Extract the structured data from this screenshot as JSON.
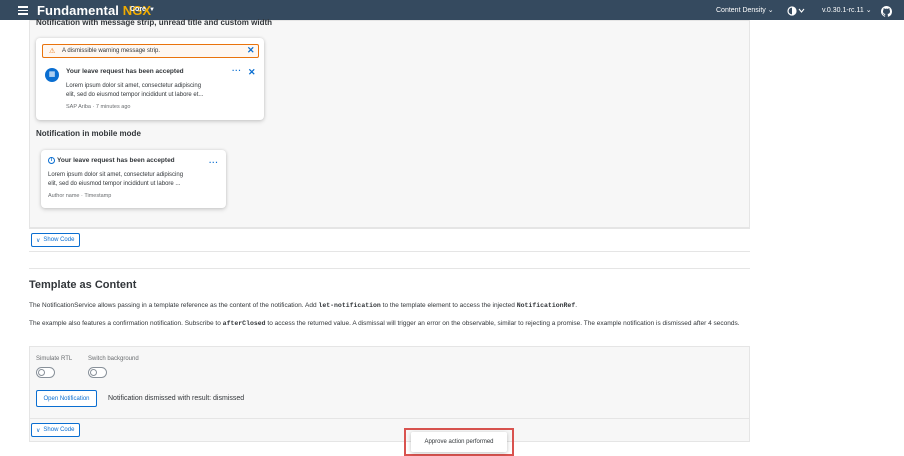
{
  "shell": {
    "brand_main": "Fundamental",
    "brand_accent": "NGX",
    "product": "Core",
    "content_density": "Content Density",
    "theme_icon": "theme-icon",
    "version": "v.0.30.1-rc.11",
    "github_icon": "github-icon"
  },
  "section1": {
    "title": "Notification with message strip, unread title and custom width",
    "strip_text": "A dismissible warning message strip.",
    "card_title": "Your leave request has been accepted",
    "card_body_1": "Lorem ipsum dolor sit amet, consectetur adipiscing",
    "card_body_2": "elit, sed do eiusmod tempor incididunt ut labore et...",
    "card_footer_source": "SAP Ariba",
    "card_footer_sep": "·",
    "card_footer_time": "7 minutes ago",
    "mobile_title": "Notification in mobile mode",
    "mobile_card_title": "Your leave request has been accepted",
    "mobile_body_1": "Lorem ipsum dolor sit amet, consectetur adipiscing",
    "mobile_body_2": "elit, sed do eiusmod tempor incididunt ut labore ...",
    "mobile_footer_author": "Author name",
    "mobile_footer_sep": "·",
    "mobile_footer_time": "Timestamp",
    "show_code": "Show Code"
  },
  "section2": {
    "title": "Template as Content",
    "para1_a": "The NotificationService allows passing in a template reference as the content of the notification. Add",
    "para1_code1": "let-notification",
    "para1_b": "to the template element to access the injected",
    "para1_code2": "NotificationRef",
    "para1_c": ".",
    "para2_a": "The example also features a confirmation notification. Subscribe to",
    "para2_code": "afterClosed",
    "para2_b": "to access the returned value. A dismissal will trigger an error on the observable, similar to rejecting a promise. The example notification is",
    "para2_c": "dismissed after 4 seconds.",
    "simulate_rtl": "Simulate RTL",
    "switch_background": "Switch background",
    "open_notification": "Open Notification",
    "result": "Notification dismissed with result: dismissed",
    "show_code": "Show Code"
  },
  "toast": {
    "text": "Approve action performed"
  },
  "colors": {
    "shell_bg": "#354a5f",
    "accent": "#f0ab00",
    "link_blue": "#0a6ed1",
    "warning": "#e9730c",
    "highlight_red": "#d9534f"
  }
}
